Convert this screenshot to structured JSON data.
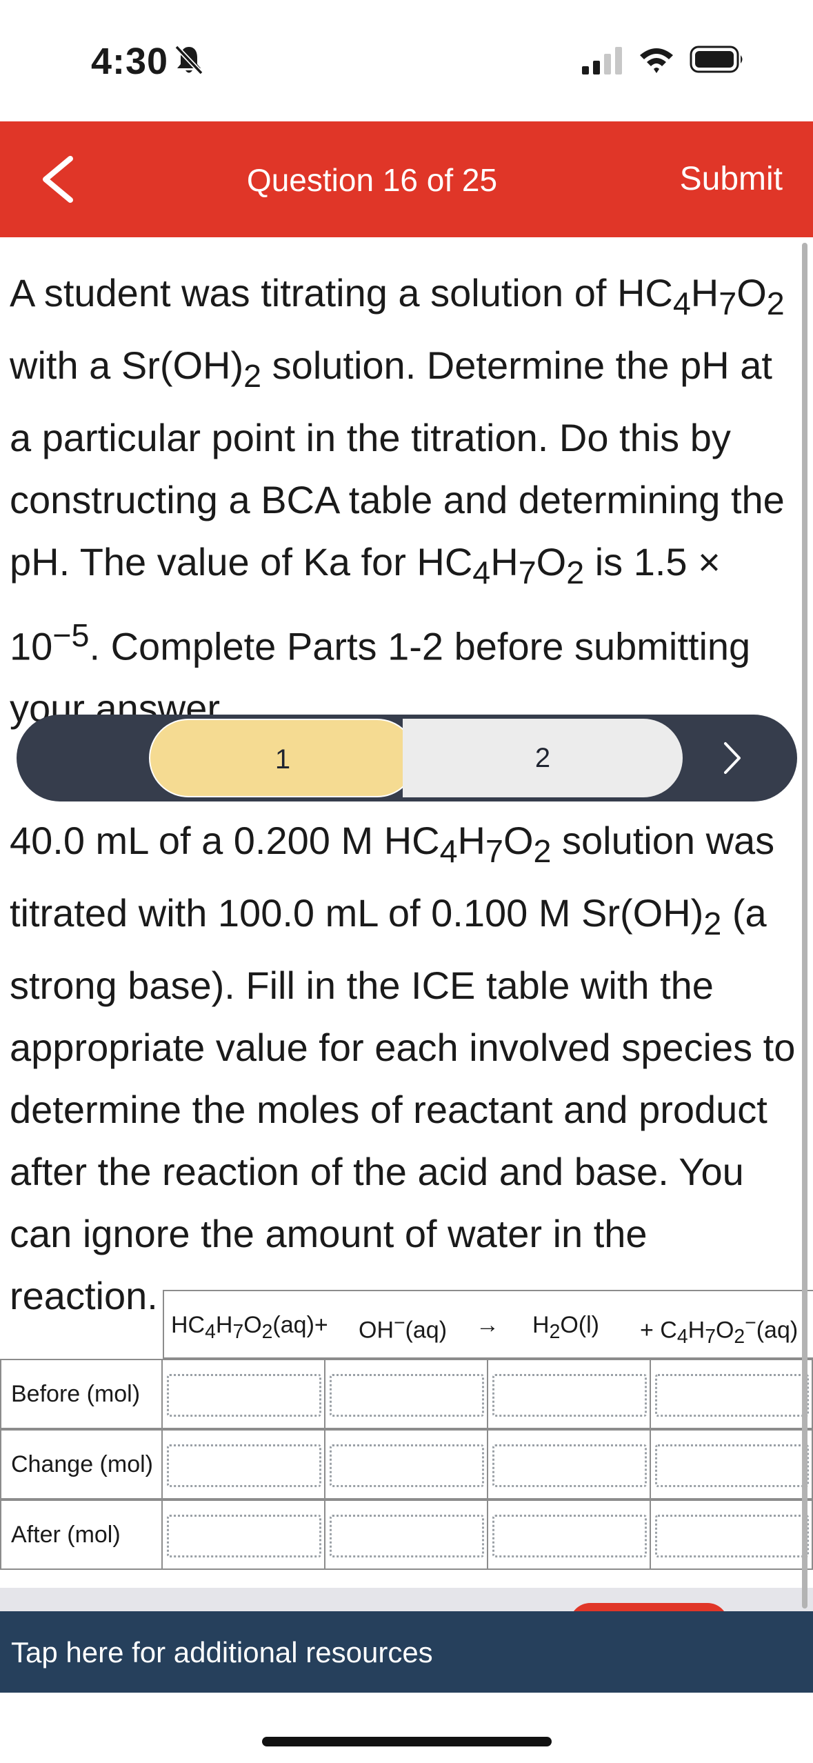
{
  "status_bar": {
    "time": "4:30"
  },
  "header": {
    "title": "Question 16 of 25",
    "submit_label": "Submit",
    "color": "#e03628"
  },
  "question": {
    "intro_html": "A student was titrating a solution of HC<sub>4</sub>H<sub>7</sub>O<sub>2</sub> with a Sr(OH)<sub>2</sub> solution. Determine the pH at a particular point in the titration. Do this by constructing a BCA table and determining the pH. The value of Ka for HC<sub>4</sub>H<sub>7</sub>O<sub>2</sub> is 1.5 × 10<sup>−5</sup>. Complete Parts 1-2 before submitting your answer."
  },
  "parts": {
    "items": [
      "1",
      "2"
    ],
    "active": "1"
  },
  "part_text_html": "40.0 mL of a 0.200 M HC<sub>4</sub>H<sub>7</sub>O<sub>2</sub> solution was titrated with 100.0 mL of 0.100 M Sr(OH)<sub>2</sub> (a strong base). Fill in the ICE table with the appropriate value for each involved species to determine the moles of reactant and product after the reaction of the acid and base. You can ignore the amount of water in the reaction.",
  "bca_table": {
    "columns_html": [
      "HC<sub>4</sub>H<sub>7</sub>O<sub>2</sub>(aq)+",
      "OH<sup>−</sup>(aq)",
      "→",
      "H<sub>2</sub>O(l)",
      "+ C<sub>4</sub>H<sub>7</sub>O<sub>2</sub><sup>−</sup>(aq)"
    ],
    "rows": [
      {
        "label": "Before (mol)",
        "values": [
          "",
          "",
          "",
          ""
        ]
      },
      {
        "label": "Change (mol)",
        "values": [
          "",
          "",
          "",
          ""
        ]
      },
      {
        "label": "After (mol)",
        "values": [
          "",
          "",
          "",
          ""
        ]
      }
    ]
  },
  "footer": {
    "resources_label": "Tap here for additional resources",
    "color": "#26405c"
  }
}
